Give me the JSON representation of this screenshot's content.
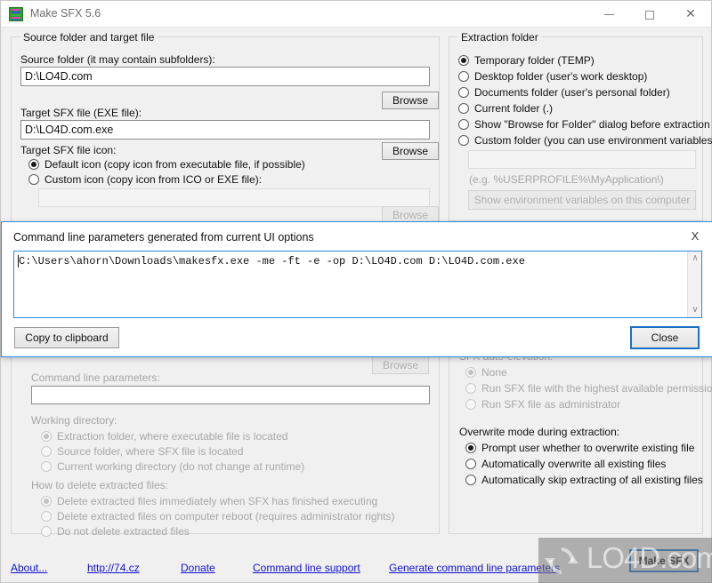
{
  "window": {
    "title": "Make SFX 5.6",
    "icon": "app-stripes-icon",
    "minimize_label": "Minimize",
    "maximize_label": "Maximize",
    "close_label": "Close"
  },
  "source_group": {
    "legend": "Source folder and target file",
    "source_label": "Source folder (it may contain subfolders):",
    "source_value": "D:\\LO4D.com",
    "source_browse": "Browse",
    "target_label": "Target SFX file (EXE file):",
    "target_value": "D:\\LO4D.com.exe",
    "target_browse": "Browse",
    "icon_label": "Target SFX file icon:",
    "icon_browse": "Browse",
    "radio_default": "Default icon (copy icon from executable file, if possible)",
    "radio_custom": "Custom icon (copy icon from ICO or EXE file):",
    "custom_icon_value": "",
    "custom_icon_browse": "Browse"
  },
  "extract_group": {
    "legend": "Extraction folder",
    "options": [
      "Temporary folder (TEMP)",
      "Desktop folder (user's work desktop)",
      "Documents folder (user's personal folder)",
      "Current folder (.)",
      "Show \"Browse for Folder\" dialog before extraction",
      "Custom folder (you can use environment variables):"
    ],
    "selected_index": 0,
    "custom_folder_value": "",
    "custom_hint": "(e.g. %USERPROFILE%\\MyApplication\\)",
    "env_button": "Show environment variables on this computer"
  },
  "exec_group": {
    "exe_browse": "Browse",
    "params_label": "Command line parameters:",
    "params_value": "",
    "workdir_label": "Working directory:",
    "workdir_options": [
      "Extraction folder, where executable file is located",
      "Source folder, where SFX file is located",
      "Current working directory (do not change at runtime)"
    ],
    "workdir_selected": 0,
    "delete_label": "How to delete extracted files:",
    "delete_options": [
      "Delete extracted files immediately when SFX has finished executing",
      "Delete extracted files on computer reboot (requires administrator rights)",
      "Do not delete extracted files"
    ],
    "delete_selected": 0
  },
  "run_group": {
    "elevation_label": "SFX auto-elevation:",
    "elevation_options": [
      "None",
      "Run SFX file with the highest available permission",
      "Run SFX file as administrator"
    ],
    "elevation_selected": 0,
    "overwrite_label": "Overwrite mode during extraction:",
    "overwrite_options": [
      "Prompt user whether to overwrite existing file",
      "Automatically overwrite all existing files",
      "Automatically skip extracting of all existing files"
    ],
    "overwrite_selected": 0
  },
  "footer": {
    "links": [
      "About...",
      "http://74.cz",
      "Donate",
      "Command line support",
      "Generate command line parameters"
    ],
    "make_sfx_button": "Make SFX"
  },
  "watermark": {
    "text": "LO4D.com",
    "logo": "circular-arrows-logo"
  },
  "modal": {
    "title": "Command line parameters generated from current UI options",
    "close_icon": "X",
    "command": "C:\\Users\\ahorn\\Downloads\\makesfx.exe -me -ft -e -op D:\\LO4D.com D:\\LO4D.com.exe",
    "copy_button": "Copy to clipboard",
    "close_button": "Close",
    "scroll_up": "∧",
    "scroll_down": "∨"
  }
}
